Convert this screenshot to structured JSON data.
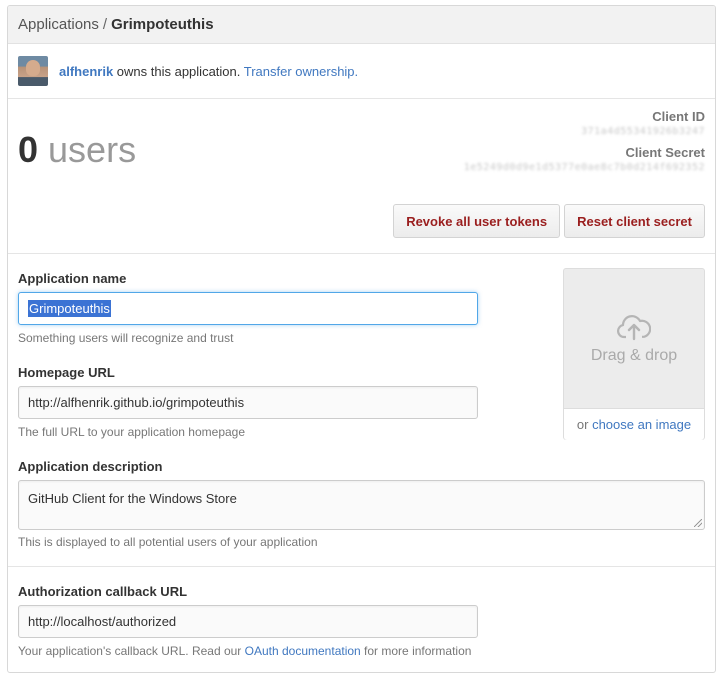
{
  "breadcrumb": {
    "parent": "Applications",
    "separator": "/",
    "current": "Grimpoteuthis"
  },
  "owner": {
    "name": "alfhenrik",
    "text": " owns this application. ",
    "transfer_link": "Transfer ownership."
  },
  "stats": {
    "count": "0",
    "unit": " users"
  },
  "credentials": {
    "client_id_label": "Client ID",
    "client_id_value": "371a4d55341926b3247",
    "client_secret_label": "Client Secret",
    "client_secret_value": "1e5249d0d9e1d5377e0ae8c7b0d214f692352"
  },
  "buttons": {
    "revoke": "Revoke all user tokens",
    "reset": "Reset client secret"
  },
  "form": {
    "name_label": "Application name",
    "name_value": "Grimpoteuthis",
    "name_note": "Something users will recognize and trust",
    "homepage_label": "Homepage URL",
    "homepage_value": "http://alfhenrik.github.io/grimpoteuthis",
    "homepage_note": "The full URL to your application homepage",
    "description_label": "Application description",
    "description_value": "GitHub Client for the Windows Store",
    "description_note": "This is displayed to all potential users of your application",
    "callback_label": "Authorization callback URL",
    "callback_value": "http://localhost/authorized",
    "callback_note_prefix": "Your application's callback URL. Read our ",
    "callback_note_link": "OAuth documentation",
    "callback_note_suffix": " for more information"
  },
  "dropzone": {
    "label": "Drag & drop",
    "or": "or ",
    "choose_link": "choose an image"
  },
  "icons": {
    "upload": "cloud-upload-icon",
    "avatar": "avatar-photo"
  }
}
